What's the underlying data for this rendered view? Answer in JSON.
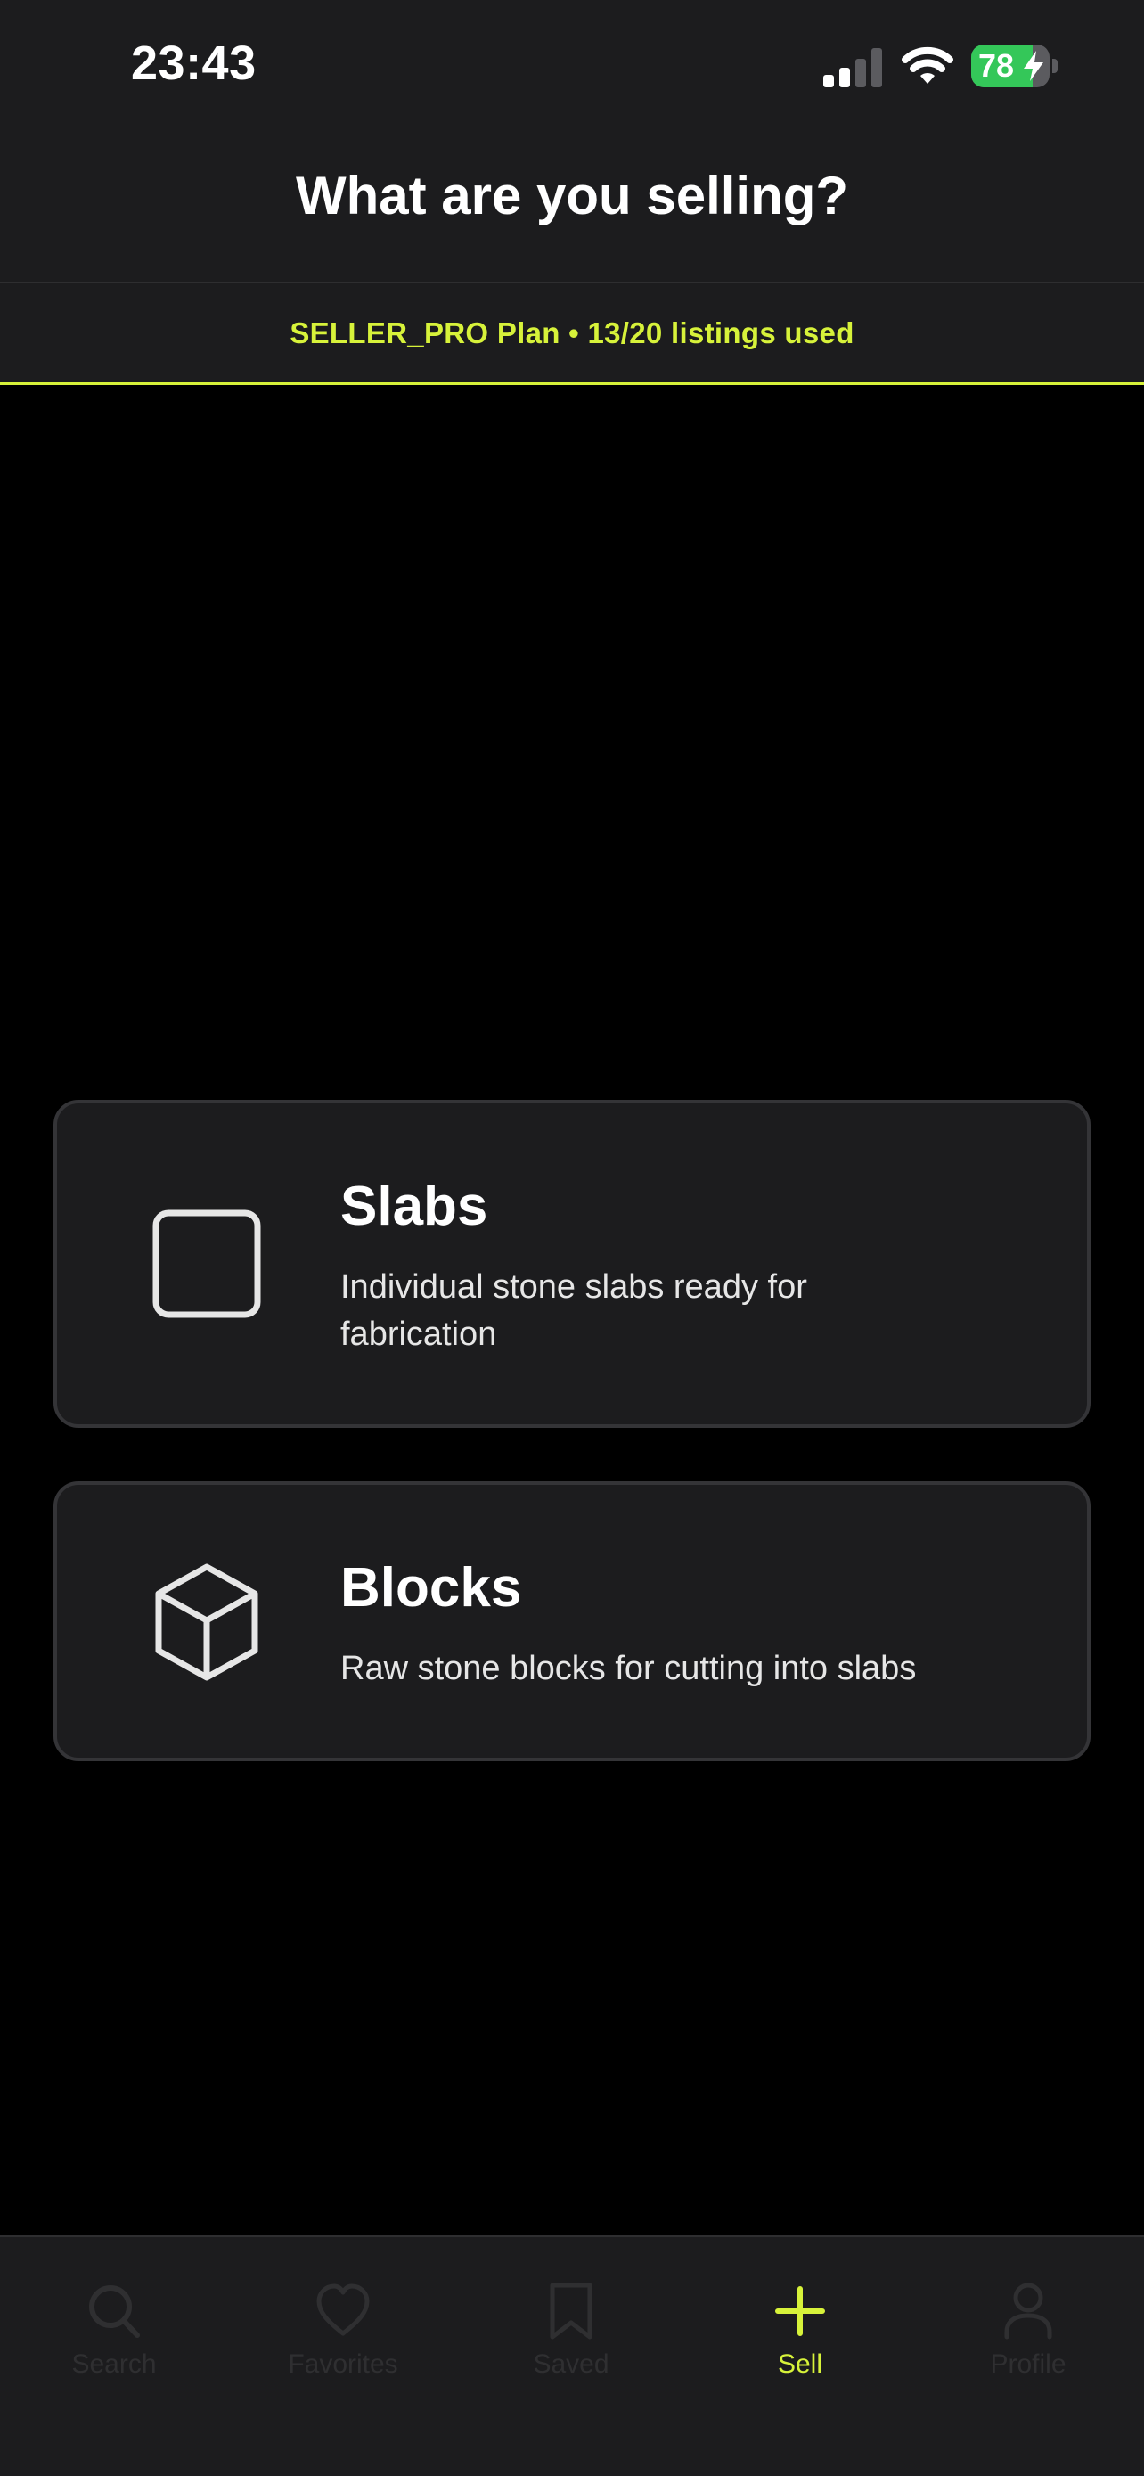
{
  "status_bar": {
    "time": "23:43",
    "battery_percent": 78,
    "battery_label": "78",
    "icons": [
      "cellular-signal-icon",
      "wifi-icon",
      "battery-charging-icon"
    ]
  },
  "header": {
    "title": "What are you selling?"
  },
  "plan_banner": {
    "text": "SELLER_PRO Plan • 13/20 listings used"
  },
  "options": [
    {
      "title": "Slabs",
      "description": "Individual stone slabs ready for fabrication",
      "icon": "square-icon"
    },
    {
      "title": "Blocks",
      "description": "Raw stone blocks for cutting into slabs",
      "icon": "cube-icon"
    }
  ],
  "tab_bar": {
    "items": [
      {
        "label": "Search",
        "icon": "search-icon",
        "active": false
      },
      {
        "label": "Favorites",
        "icon": "heart-icon",
        "active": false
      },
      {
        "label": "Saved",
        "icon": "bookmark-icon",
        "active": false
      },
      {
        "label": "Sell",
        "icon": "plus-icon",
        "active": true
      },
      {
        "label": "Profile",
        "icon": "person-icon",
        "active": false
      }
    ]
  },
  "colors": {
    "accent": "#d7f23a",
    "background": "#000000",
    "surface": "#1c1c1e",
    "battery_green": "#34c759",
    "inactive_tab": "#2f2f31"
  }
}
